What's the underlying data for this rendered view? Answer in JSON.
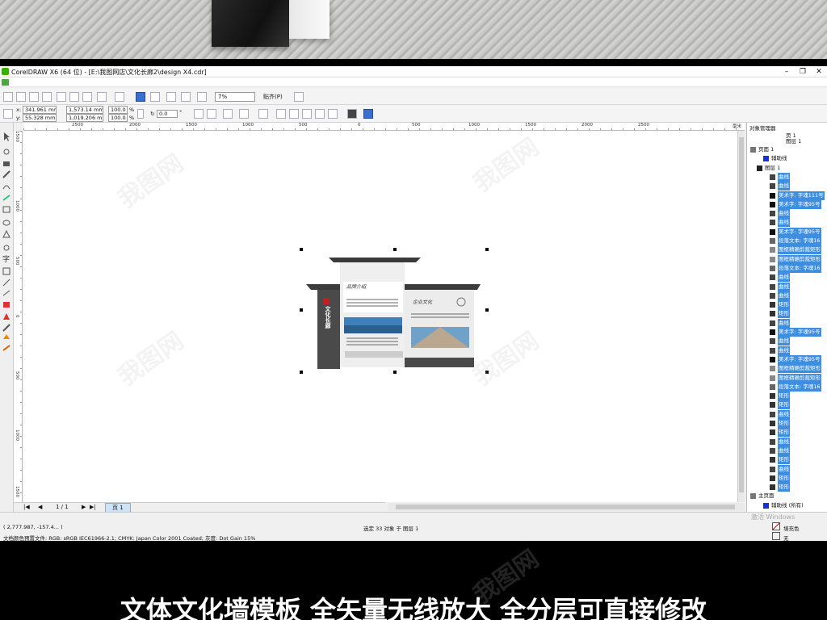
{
  "app": {
    "title": "CorelDRAW X6 (64 位) - [E:\\我图网店\\文化长廊2\\design X4.cdr]",
    "zoom": "7%",
    "snap_label": "贴齐(P)",
    "colors": {
      "accent": "#3d8ee0",
      "title_icon": "#38b000"
    }
  },
  "props": {
    "x_label": "x:",
    "x_value": "341.961 mm",
    "y_label": "y:",
    "y_value": "55.328 mm",
    "w_value": "1,573.14 mm",
    "h_value": "1,019.206 mm",
    "scale_w": "100.0",
    "scale_h": "100.0",
    "percent": "%",
    "angle": "0.0",
    "angle_unit": "°"
  },
  "ruler": {
    "h_ticks": [
      "2500",
      "2000",
      "1500",
      "1000",
      "500",
      "0",
      "500",
      "1000",
      "1500",
      "2000",
      "2500"
    ],
    "v_ticks": [
      "1500",
      "1000",
      "500",
      "0",
      "500",
      "1000",
      "1500"
    ],
    "unit": "毫米"
  },
  "object_manager": {
    "title": "对象管理器",
    "page_label": "页 1",
    "layer_label": "图层 1",
    "items": [
      {
        "label": "页面 1",
        "selected": false,
        "indent": 0,
        "icon": "page"
      },
      {
        "label": "辅助线",
        "selected": false,
        "indent": 2,
        "icon": "layer-blue"
      },
      {
        "label": "图层 1",
        "selected": false,
        "indent": 1,
        "icon": "layer-red"
      },
      {
        "label": "曲线",
        "selected": true,
        "indent": 3,
        "icon": "curve"
      },
      {
        "label": "曲线",
        "selected": true,
        "indent": 3,
        "icon": "curve"
      },
      {
        "label": "美术字: 字魂111号",
        "selected": true,
        "indent": 3,
        "icon": "text"
      },
      {
        "label": "美术字: 字魂95号",
        "selected": true,
        "indent": 3,
        "icon": "text"
      },
      {
        "label": "曲线",
        "selected": true,
        "indent": 3,
        "icon": "curve"
      },
      {
        "label": "曲线",
        "selected": true,
        "indent": 3,
        "icon": "curve"
      },
      {
        "label": "美术字: 字魂95号",
        "selected": true,
        "indent": 3,
        "icon": "text"
      },
      {
        "label": "段落文本: 字魂16",
        "selected": true,
        "indent": 3,
        "icon": "para"
      },
      {
        "label": "图框精确剪裁矩形",
        "selected": true,
        "indent": 3,
        "icon": "clip"
      },
      {
        "label": "图框精确剪裁矩形",
        "selected": true,
        "indent": 3,
        "icon": "clip"
      },
      {
        "label": "段落文本: 字魂16",
        "selected": true,
        "indent": 3,
        "icon": "para"
      },
      {
        "label": "曲线",
        "selected": true,
        "indent": 3,
        "icon": "curve"
      },
      {
        "label": "曲线",
        "selected": true,
        "indent": 3,
        "icon": "curve"
      },
      {
        "label": "曲线",
        "selected": true,
        "indent": 3,
        "icon": "curve"
      },
      {
        "label": "矩形",
        "selected": true,
        "indent": 3,
        "icon": "rect"
      },
      {
        "label": "矩形",
        "selected": true,
        "indent": 3,
        "icon": "rect"
      },
      {
        "label": "曲线",
        "selected": true,
        "indent": 3,
        "icon": "curve"
      },
      {
        "label": "美术字: 字魂95号",
        "selected": true,
        "indent": 3,
        "icon": "text"
      },
      {
        "label": "曲线",
        "selected": true,
        "indent": 3,
        "icon": "curve"
      },
      {
        "label": "曲线",
        "selected": true,
        "indent": 3,
        "icon": "curve"
      },
      {
        "label": "美术字: 字魂95号",
        "selected": true,
        "indent": 3,
        "icon": "text"
      },
      {
        "label": "图框精确剪裁矩形",
        "selected": true,
        "indent": 3,
        "icon": "clip"
      },
      {
        "label": "图框精确剪裁矩形",
        "selected": true,
        "indent": 3,
        "icon": "clip"
      },
      {
        "label": "段落文本: 字魂16",
        "selected": true,
        "indent": 3,
        "icon": "para"
      },
      {
        "label": "矩形",
        "selected": true,
        "indent": 3,
        "icon": "rect"
      },
      {
        "label": "矩形",
        "selected": true,
        "indent": 3,
        "icon": "rect"
      },
      {
        "label": "曲线",
        "selected": true,
        "indent": 3,
        "icon": "curve"
      },
      {
        "label": "矩形",
        "selected": true,
        "indent": 3,
        "icon": "rect"
      },
      {
        "label": "矩形",
        "selected": true,
        "indent": 3,
        "icon": "rect"
      },
      {
        "label": "曲线",
        "selected": true,
        "indent": 3,
        "icon": "curve"
      },
      {
        "label": "曲线",
        "selected": true,
        "indent": 3,
        "icon": "curve"
      },
      {
        "label": "矩形",
        "selected": true,
        "indent": 3,
        "icon": "rect"
      },
      {
        "label": "曲线",
        "selected": true,
        "indent": 3,
        "icon": "curve"
      },
      {
        "label": "矩形",
        "selected": true,
        "indent": 3,
        "icon": "rect"
      },
      {
        "label": "矩形",
        "selected": true,
        "indent": 3,
        "icon": "rect"
      },
      {
        "label": "主页面",
        "selected": false,
        "indent": 0,
        "icon": "page"
      },
      {
        "label": "辅助线 (所有)",
        "selected": false,
        "indent": 2,
        "icon": "layer-blue"
      },
      {
        "label": "桌面",
        "selected": false,
        "indent": 2,
        "icon": "layer-red"
      }
    ]
  },
  "pagebar": {
    "page_count": "1 / 1",
    "page_tab": "页 1"
  },
  "status": {
    "coords": "( 2,777.987, -157.4... )",
    "selection": "选定 33 对象 于 图层 1",
    "color_profile": "文档颜色预置文件: RGB: sRGB IEC61966-2.1; CMYK: Japan Color 2001 Coated; 灰度: Dot Gain 15%",
    "fill_label": "填充色",
    "outline_label": "无",
    "windows_activate": "激活 Windows"
  },
  "drawing": {
    "vertical_title": "文化长廊",
    "header_text_1": "品牌介绍",
    "header_text_2": "企业文化"
  },
  "watermark": "我图网",
  "caption": "文体文化墙模板  全矢量无线放大 全分层可直接修改"
}
